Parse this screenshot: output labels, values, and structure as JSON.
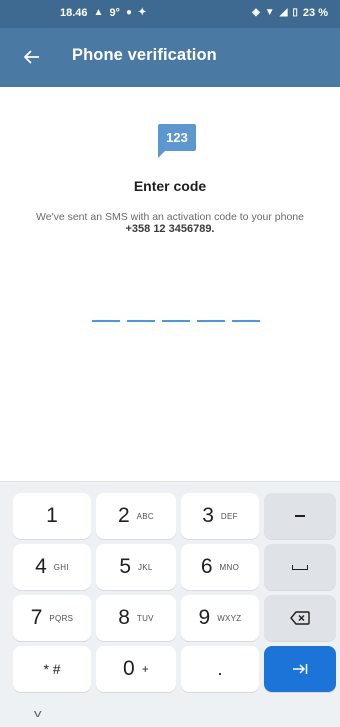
{
  "status_bar": {
    "time": "18.46",
    "temp": "9°",
    "battery": "23 %"
  },
  "app_bar": {
    "title": "Phone verification"
  },
  "main": {
    "badge": "123",
    "heading": "Enter code",
    "message": "We've sent an SMS with an activation code to your phone",
    "phone_number": "+358 12 3456789.",
    "code_slots": 5
  },
  "keyboard": {
    "keys": {
      "k1": {
        "num": "1",
        "letters": ""
      },
      "k2": {
        "num": "2",
        "letters": "ABC"
      },
      "k3": {
        "num": "3",
        "letters": "DEF"
      },
      "k4": {
        "num": "4",
        "letters": "GHI"
      },
      "k5": {
        "num": "5",
        "letters": "JKL"
      },
      "k6": {
        "num": "6",
        "letters": "MNO"
      },
      "k7": {
        "num": "7",
        "letters": "PQRS"
      },
      "k8": {
        "num": "8",
        "letters": "TUV"
      },
      "k9": {
        "num": "9",
        "letters": "WXYZ"
      },
      "k0": {
        "num": "0",
        "letters": "+"
      },
      "star": "* #",
      "dot": "."
    },
    "accent_color": "#1d74d8"
  },
  "colors": {
    "app_bar": "#4a7aa4",
    "status_bar": "#3e6a91",
    "code_underline": "#4a9ad8"
  }
}
